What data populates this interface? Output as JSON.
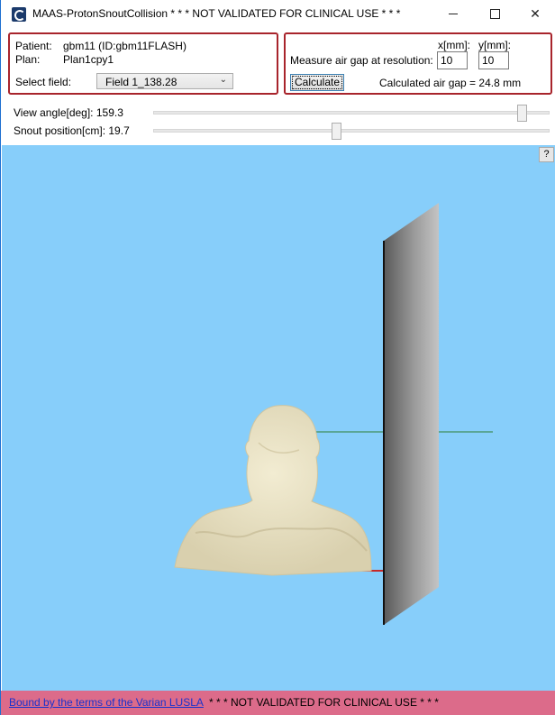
{
  "window": {
    "title": "MAAS-ProtonSnoutCollision * * * NOT VALIDATED FOR CLINICAL USE * * *"
  },
  "patient_panel": {
    "patient_label": "Patient:",
    "patient_value": "gbm11 (ID:gbm11FLASH)",
    "plan_label": "Plan:",
    "plan_value": "Plan1cpy1",
    "field_label": "Select field:",
    "field_value": "Field 1_138.28"
  },
  "airgap_panel": {
    "x_label": "x[mm]:",
    "y_label": "y[mm]:",
    "measure_label": "Measure air gap at resolution:",
    "x_value": "10",
    "y_value": "10",
    "calculate_label": "Calculate",
    "result_text": "Calculated air gap = 24.8 mm"
  },
  "sliders": {
    "view_angle_label": "View angle[deg]: 159.3",
    "view_angle_fraction": 0.94,
    "snout_label": "Snout position[cm]: 19.7",
    "snout_fraction": 0.46
  },
  "viewport": {
    "help_label": "?",
    "background": "#87cefa"
  },
  "footer": {
    "link_text": "Bound by the terms of the Varian LUSLA",
    "warning_text": "* * * NOT VALIDATED FOR CLINICAL USE * * *",
    "background": "#dc6b8a"
  }
}
